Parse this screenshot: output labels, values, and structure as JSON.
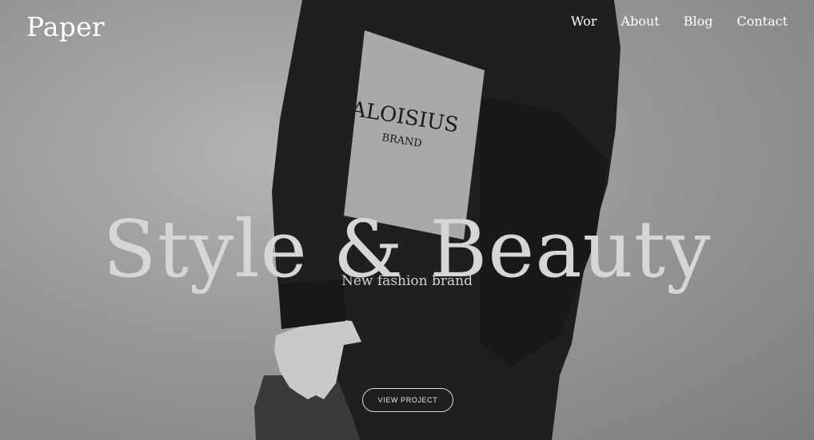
{
  "brand": {
    "logo_text": "Paper"
  },
  "nav": {
    "items": [
      {
        "label": "Wor"
      },
      {
        "label": "About"
      },
      {
        "label": "Blog"
      },
      {
        "label": "Contact"
      }
    ]
  },
  "hero": {
    "headline": "Style & Beauty",
    "subtitle": "New fashion brand",
    "cta_label": "VIEW PROJECT",
    "patch_line1": "ALOISIUS",
    "patch_line2": "BRAND"
  },
  "colors": {
    "background": "#8e8e8e",
    "nav_text": "#ffffff",
    "headline_text": "#d6d6d6",
    "sweater": "#1e1e1e"
  }
}
